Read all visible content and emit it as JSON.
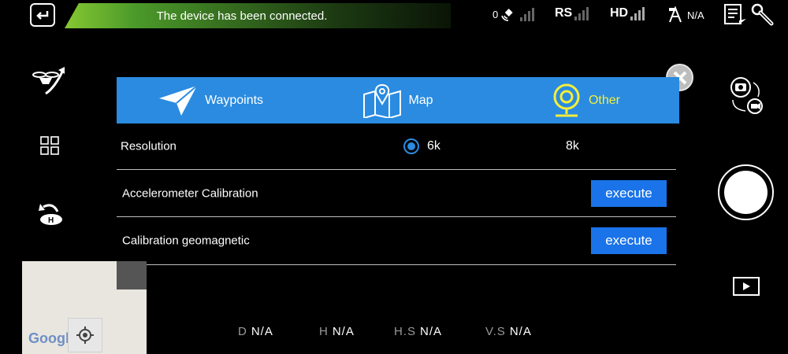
{
  "status_bar": {
    "connection_message": "The device has been connected.",
    "satellite_count": "0",
    "rs_label": "RS",
    "hd_label": "HD",
    "flight_mode_value": "N/A"
  },
  "tabs": [
    {
      "label": "Waypoints",
      "icon": "paper-plane-icon",
      "active": false
    },
    {
      "label": "Map",
      "icon": "map-pin-icon",
      "active": false
    },
    {
      "label": "Other",
      "icon": "webcam-icon",
      "active": true
    }
  ],
  "settings": {
    "resolution": {
      "label": "Resolution",
      "options": [
        "6k",
        "8k"
      ],
      "selected": "6k"
    },
    "accelerometer": {
      "label": "Accelerometer Calibration",
      "button": "execute"
    },
    "geomagnetic": {
      "label": "Calibration geomagnetic",
      "button": "execute"
    }
  },
  "map": {
    "logo": "Google"
  },
  "telemetry": {
    "d": {
      "label": "D",
      "value": "N/A"
    },
    "h": {
      "label": "H",
      "value": "N/A"
    },
    "hs": {
      "label": "H.S",
      "value": "N/A"
    },
    "vs": {
      "label": "V.S",
      "value": "N/A"
    }
  },
  "colors": {
    "accent": "#2a8be0",
    "active_tab": "#f4ee3a",
    "button": "#1a73e8"
  }
}
